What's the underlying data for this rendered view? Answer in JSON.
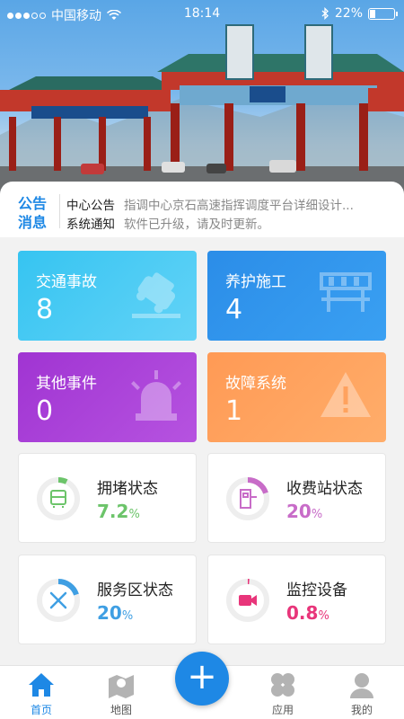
{
  "status_bar": {
    "carrier": "中国移动",
    "time": "18:14",
    "battery": "22%",
    "battery_level": 0.22
  },
  "notice": {
    "tag_line1": "公告",
    "tag_line2": "消息",
    "items": [
      {
        "kind": "中心公告",
        "text": "指调中心京石高速指挥调度平台详细设计..."
      },
      {
        "kind": "系统通知",
        "text": "软件已升级，请及时更新。"
      }
    ]
  },
  "events": {
    "traffic": {
      "label": "交通事故",
      "count": "8",
      "icon": "car-accident-icon"
    },
    "maintenance": {
      "label": "养护施工",
      "count": "4",
      "icon": "barrier-icon"
    },
    "other": {
      "label": "其他事件",
      "count": "0",
      "icon": "alarm-light-icon"
    },
    "fault": {
      "label": "故障系统",
      "count": "1",
      "icon": "warning-icon"
    }
  },
  "stats": {
    "congestion": {
      "label": "拥堵状态",
      "value": "7.2",
      "unit": "%",
      "fraction": 0.072,
      "color": "#6cc46a",
      "icon": "bus-icon"
    },
    "toll": {
      "label": "收费站状态",
      "value": "20",
      "unit": "%",
      "fraction": 0.2,
      "color": "#c86cc8",
      "icon": "toll-gate-icon"
    },
    "service": {
      "label": "服务区状态",
      "value": "20",
      "unit": "%",
      "fraction": 0.2,
      "color": "#3f9fe3",
      "icon": "fork-knife-icon"
    },
    "monitor": {
      "label": "监控设备",
      "value": "0.8",
      "unit": "%",
      "fraction": 0.008,
      "color": "#e8357a",
      "icon": "camera-icon"
    }
  },
  "tabbar": {
    "home": "首页",
    "map": "地图",
    "add": "+",
    "apps": "应用",
    "mine": "我的"
  },
  "colors": {
    "accent": "#1e88e5"
  }
}
